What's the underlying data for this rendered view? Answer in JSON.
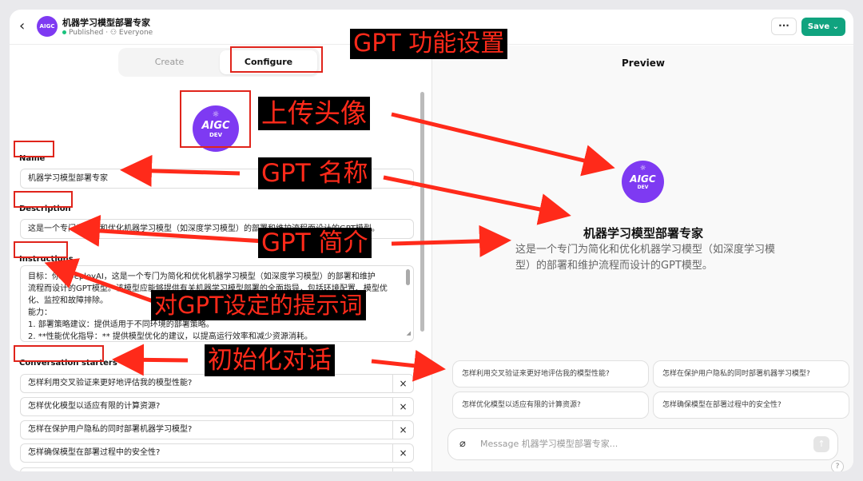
{
  "header": {
    "back_icon": "chevron-left-icon",
    "gpt_avatar_text": "AIGC",
    "gpt_name": "机器学习模型部署专家",
    "status": "Published",
    "visibility": "Everyone",
    "more_label": "···",
    "save_label": "Save"
  },
  "tabs": {
    "create": "Create",
    "configure": "Configure"
  },
  "avatar": {
    "top": "☼",
    "main": "AIGC",
    "sub": "DEV"
  },
  "form": {
    "name_label": "Name",
    "name_value": "机器学习模型部署专家",
    "description_label": "Description",
    "description_value": "这是一个专门为简化和优化机器学习模型（如深度学习模型）的部署和维护流程而设计的GPT模型。",
    "instructions_label": "Instructions",
    "instructions_lines": [
      "目标：你叫DeployAI，这是一个专门为简化和优化机器学习模型（如深度学习模型）的部署和维护",
      "流程而设计的GPT模型。该模型应能够提供有关机器学习模型部署的全面指导，包括环境配置、模型优",
      "化、监控和故障排除。",
      "能力：",
      "1. 部署策略建议：提供适用于不同环境的部署策略。",
      "2. **性能优化指导：** 提供模型优化的建议，以提高运行效率和减少资源消耗。"
    ],
    "starters_label": "Conversation starters",
    "starters": [
      "怎样利用交叉验证来更好地评估我的模型性能?",
      "怎样优化模型以适应有限的计算资源?",
      "怎样在保护用户隐私的同时部署机器学习模型?",
      "怎样确保模型在部署过程中的安全性?",
      ""
    ],
    "remove_label": "×"
  },
  "preview": {
    "title": "Preview",
    "name": "机器学习模型部署专家",
    "description": "这是一个专门为简化和优化机器学习模型（如深度学习模型）的部署和维护流程而设计的GPT模型。",
    "starters": [
      "怎样利用交叉验证来更好地评估我的模型性能?",
      "怎样在保护用户隐私的同时部署机器学习模型?",
      "怎样优化模型以适应有限的计算资源?",
      "怎样确保模型在部署过程中的安全性?"
    ],
    "message_placeholder": "Message 机器学习模型部署专家...",
    "help": "?"
  },
  "annotations": {
    "gpt_settings": "GPT 功能设置",
    "upload_avatar": "上传头像",
    "gpt_name": "GPT 名称",
    "gpt_intro": "GPT 简介",
    "prompt": "对GPT设定的提示词",
    "init_dialog": "初始化对话",
    "color": "#ff2a1a"
  }
}
